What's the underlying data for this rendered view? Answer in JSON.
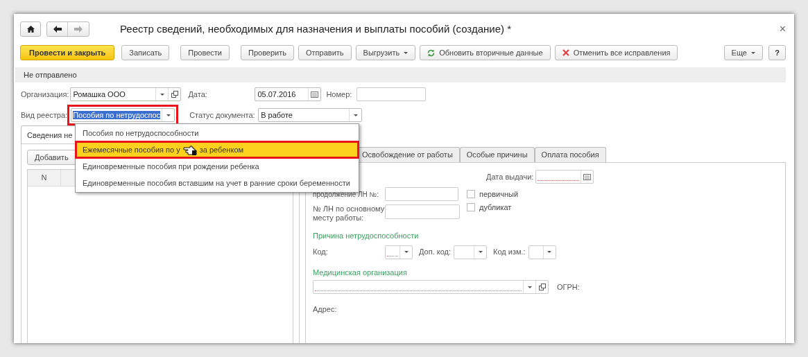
{
  "window": {
    "title": "Реестр сведений, необходимых для назначения и выплаты пособий (создание) *",
    "close": "×"
  },
  "toolbar": {
    "buttons": [
      {
        "label": "Провести и закрыть",
        "kind": "primary"
      },
      {
        "label": "Записать",
        "kind": "plain"
      },
      {
        "label": "Провести",
        "kind": "plain"
      },
      {
        "label": "Проверить",
        "kind": "plain"
      },
      {
        "label": "Отправить",
        "kind": "plain"
      },
      {
        "label": "Выгрузить",
        "kind": "dropdown"
      },
      {
        "label": "Обновить вторичные данные",
        "kind": "refresh"
      },
      {
        "label": "Отменить все исправления",
        "kind": "cancel"
      }
    ],
    "more": "Еще",
    "help": "?"
  },
  "status": "Не отправлено",
  "header": {
    "organization": {
      "label": "Организация:",
      "value": "Ромашка ООО"
    },
    "date": {
      "label": "Дата:",
      "value": "05.07.2016"
    },
    "number": {
      "label": "Номер:"
    },
    "registry_type": {
      "label": "Вид реестра:",
      "value": "Пособия по нетрудоспос",
      "annotated": true
    },
    "doc_status": {
      "label": "Статус документа:",
      "value": "В работе"
    }
  },
  "dropdown": {
    "items": [
      {
        "parts": [
          "Пособия по нетрудоспособности"
        ],
        "selected": false,
        "annotated": false
      },
      {
        "parts": [
          "Ежемесячные пособия по у",
          "за ребенком"
        ],
        "selected": true,
        "annotated": true
      },
      {
        "parts": [
          "Единовременные пособия при рождении ребенка"
        ],
        "selected": false,
        "annotated": false
      },
      {
        "parts": [
          "Единовременные пособия вставшим на учет в ранние сроки беременности"
        ],
        "selected": false,
        "annotated": false
      }
    ]
  },
  "left": {
    "tab": "Сведения не",
    "add_button": "Добавить",
    "columns": [
      "N"
    ]
  },
  "right": {
    "tabs": [
      {
        "label": "Освобождение от работы",
        "selected": false
      },
      {
        "label": "Особые причины",
        "selected": false
      },
      {
        "label": "Оплата пособия",
        "selected": false
      }
    ],
    "issue_date": "Дата выдачи:",
    "continuation": "продолжение ЛН №:",
    "checkboxes": [
      {
        "label": "первичный",
        "checked": false
      },
      {
        "label": "дубликат",
        "checked": false
      }
    ],
    "main_job": "№ ЛН по основному месту работы:",
    "reason_section": "Причина нетрудоспособности",
    "codes": [
      {
        "label": "Код:",
        "required": true
      },
      {
        "label": "Доп. код:",
        "required": false
      },
      {
        "label": "Код изм.:",
        "required": false
      }
    ],
    "med_section": "Медицинская организация",
    "ogrn": "ОГРН:",
    "address": "Адрес:"
  }
}
